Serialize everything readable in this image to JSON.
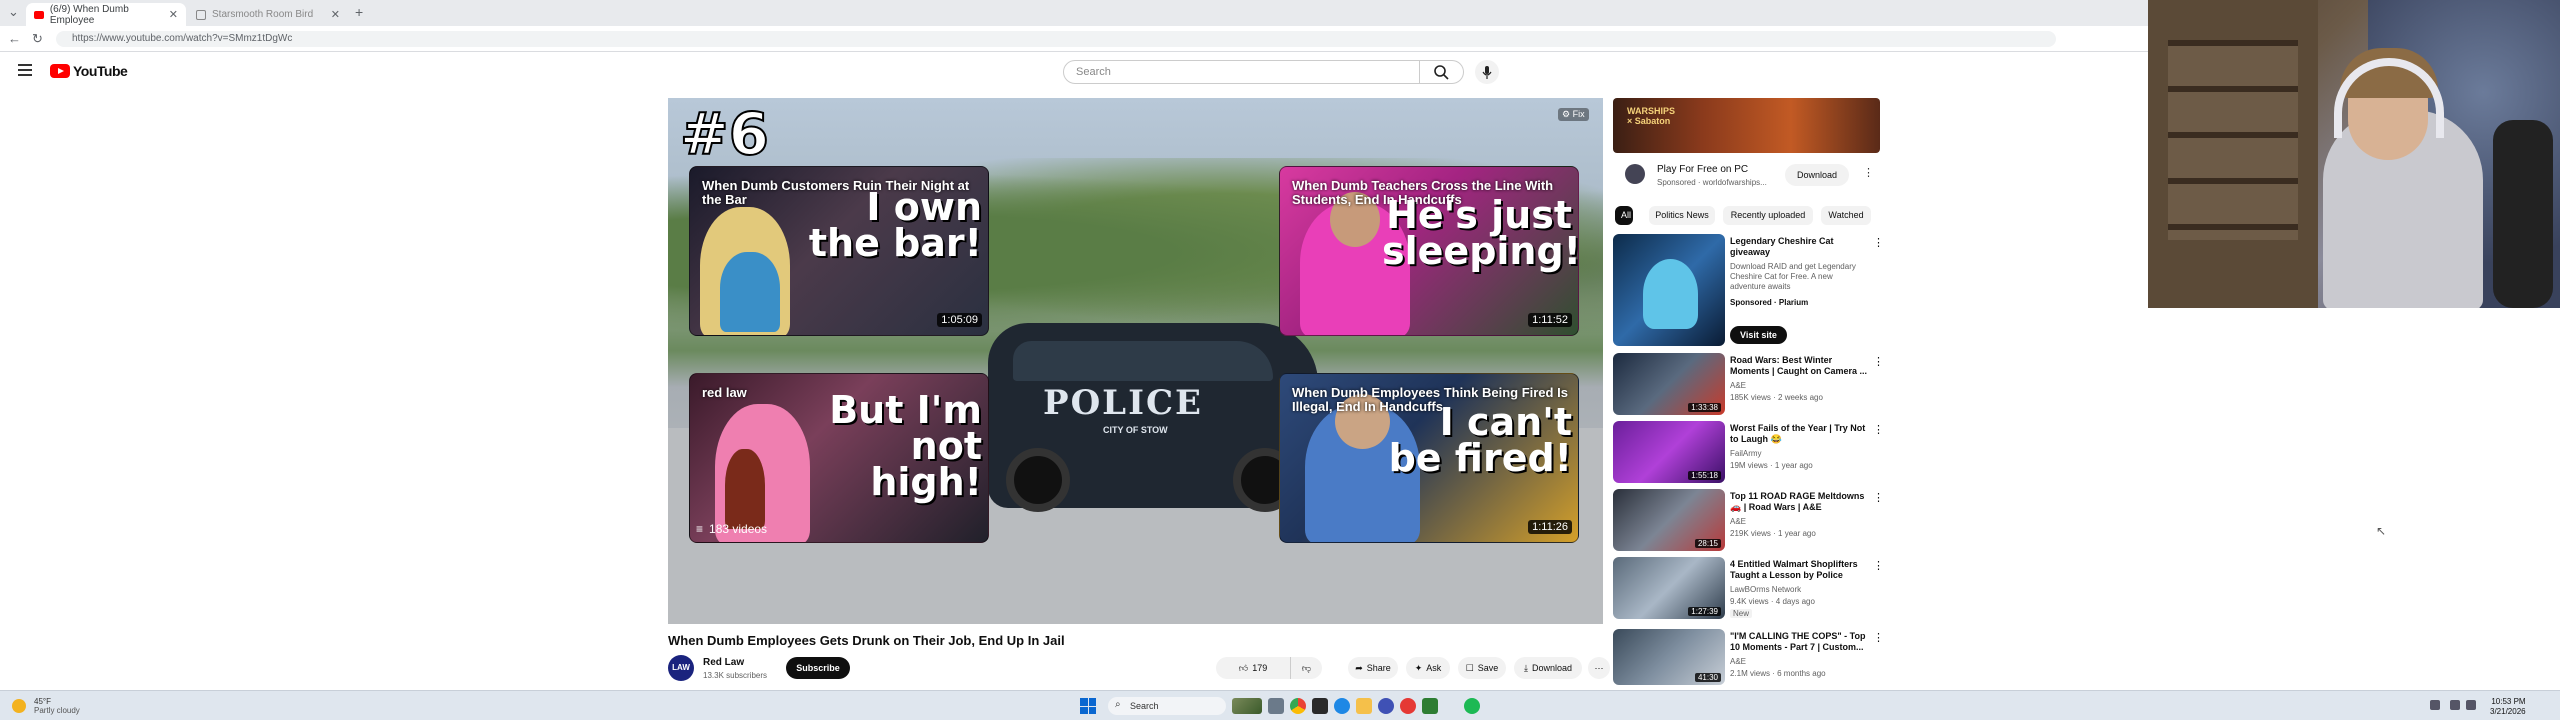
{
  "browser": {
    "tabs": [
      {
        "label": "(6/9) When Dumb Employee",
        "active": true
      },
      {
        "label": "Starsmooth Room Bird",
        "active": false
      }
    ],
    "new_tab": "+",
    "url": "https://www.youtube.com/watch?v=SMmz1tDgWc"
  },
  "header": {
    "logo_text": "YouTube",
    "search_placeholder": "Search"
  },
  "player": {
    "episode_number": "#6",
    "fix_badge": "⚙ Fix",
    "police_text": "POLICE",
    "police_sub": "CITY OF STOW",
    "cards": [
      {
        "title": "When Dumb Customers Ruin Their Night at the Bar",
        "big_text": "I own the bar!",
        "duration": "1:05:09"
      },
      {
        "title": "When Dumb Teachers Cross the Line With Students, End In Handcuffs",
        "big_text": "He's just sleeping!",
        "duration": "1:11:52"
      },
      {
        "title": "red law",
        "big_text": "But I'm not high!",
        "videos": "183 videos"
      },
      {
        "title": "When Dumb Employees Think Being Fired Is Illegal, End In Handcuffs",
        "big_text": "I can't be fired!",
        "duration": "1:11:26"
      }
    ]
  },
  "video": {
    "title": "When Dumb Employees Gets Drunk on Their Job, End Up In Jail",
    "channel": "Red Law",
    "avatar_text": "LAW",
    "subscribers": "13.3K subscribers",
    "subscribe": "Subscribe",
    "likes": "179",
    "share": "Share",
    "ask": "Ask",
    "save": "Save",
    "download": "Download",
    "more": "⋯"
  },
  "sidebar": {
    "ad_banner_text": "WARSHIPS\n× Sabaton",
    "ad_title": "Play For Free on PC",
    "ad_sub": "Sponsored · worldofwarships...",
    "ad_download": "Download",
    "chips": [
      "All",
      "Politics News",
      "Recently uploaded",
      "Watched"
    ],
    "sponsored": {
      "title": "Legendary Cheshire Cat giveaway",
      "desc": "Download RAID and get Legendary Cheshire Cat for Free. A new adventure awaits",
      "meta": "Sponsored · Plarium",
      "cta": "Visit site"
    },
    "recs": [
      {
        "title": "Road Wars: Best Winter Moments | Caught on Camera ...",
        "channel": "A&E",
        "meta": "185K views · 2 weeks ago",
        "duration": "1:33:38"
      },
      {
        "title": "Worst Fails of the Year | Try Not to Laugh 😂",
        "channel": "FailArmy",
        "meta": "19M views · 1 year ago",
        "duration": "1:55:18"
      },
      {
        "title": "Top 11 ROAD RAGE Meltdowns 🚗 | Road Wars | A&E",
        "channel": "A&E",
        "meta": "219K views · 1 year ago",
        "duration": "28:15"
      },
      {
        "title": "4 Entitled Walmart Shoplifters Taught a Lesson by Police",
        "channel": "LawBOrms Network",
        "meta": "9.4K views · 4 days ago",
        "badge": "New",
        "duration": "1:27:39"
      },
      {
        "title": "\"I'M CALLING THE COPS\" - Top 10 Moments - Part 7 | Custom...",
        "channel": "A&E",
        "meta": "2.1M views · 6 months ago",
        "duration": "41:30"
      }
    ]
  },
  "taskbar": {
    "weather_temp": "45°F",
    "weather_desc": "Partly cloudy",
    "search": "Search",
    "time": "10:53 PM",
    "date": "3/21/2026"
  },
  "colors": {
    "yt_red": "#ff0000",
    "subscribe_bg": "#0f0f0f",
    "card_big_text": "#ffffff",
    "card_big_accent": "#e52222"
  }
}
